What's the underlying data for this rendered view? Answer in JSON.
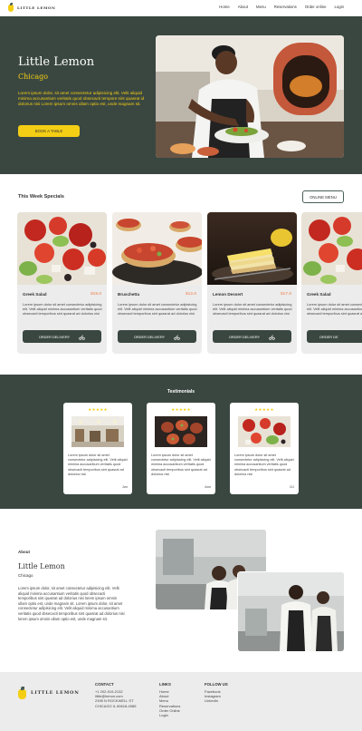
{
  "nav": {
    "logo_text": "LITTLE LEMON",
    "links": [
      "Home",
      "About",
      "Menu",
      "Reservations",
      "Order online",
      "Login"
    ]
  },
  "hero": {
    "title": "Little Lemon",
    "subtitle": "Chicago",
    "description": "Lorem ipsum dolor, sit amet consectetur adipisicing elit. Velit aliquid minima accusantium veritatis quod obsecacti tempore sint quasrat id dolorius nisi Lorem ipsum omnis ullam optio est, unde magnam sit.",
    "button": "BOOK A TABLE"
  },
  "specials": {
    "title": "This Week Specials",
    "menu_button": "ONLINE MENU",
    "items": [
      {
        "name": "Greek Salad",
        "price": "$15.0",
        "desc": "Lorem ipsum dolor sit amet consectetur adipisicing elit. Velit aliquid minima accusantium veritatis quod obsecacti temporibus sint quasrat ad dolorius nisi",
        "button": "ORDER DELIVERY"
      },
      {
        "name": "Bruschetta",
        "price": "$12.0",
        "desc": "Lorem ipsum dolor sit amet consectetur adipisicing elit. Velit aliquid minima accusantium veritatis quod obsecacti temporibus sint quasrat ad dolorius nisi",
        "button": "ORDER DELIVERY"
      },
      {
        "name": "Lemon Dessert",
        "price": "$17.0",
        "desc": "Lorem ipsum dolor sit amet consectetur adipisicing elit. Velit aliquid minima accusantium veritatis quod obsecacti temporibus sint quasrat ad dolorius nisi",
        "button": "ORDER DELIVERY"
      },
      {
        "name": "Greek Salad",
        "price": "",
        "desc": "Lorem ipsum dolor sit amet consectetur adipisicing elit. Velit aliquid minima accusantium veritatis quod obsecacti temporibus sint quasrat ad dolorius nisi",
        "button": "ORDER DE"
      }
    ]
  },
  "testimonials": {
    "title": "Testimonials",
    "items": [
      {
        "stars": "★★★★★",
        "desc": "Lorem ipsum dolor sit amet consectetur adipisicing elit. Velit aliquid minima accusantium veritatis quod obsecacti temporibus sint quasrat ad dolorius nisi",
        "name": "Jon"
      },
      {
        "stars": "★★★★★",
        "desc": "Lorem ipsum dolor sit amet consectetur adipisicing elit. Velit aliquid minima accusantium veritatis quod obsecacti temporibus sint quasrat ad dolorius nisi",
        "name": "Ann"
      },
      {
        "stars": "★★★★★",
        "desc": "Lorem ipsum dolor sit amet consectetur adipisicing elit. Velit aliquid minima accusantium veritatis quod obsecacti temporibus sint quasrat ad dolorius nisi",
        "name": "DJ"
      }
    ]
  },
  "about": {
    "label": "About",
    "title": "Little Lemon",
    "subtitle": "Chicago",
    "description": "Lorem ipsum dolor, sit amet consectetur adipisicing elit. Velit aliquid minima accusantium veritatis quod obsecacti temporibus sint quasrat ad dolorius nisi lorem ipsum omnis ullam optio est, unde magnam sit. Lorem ipsum dolor, sit amet consectetur adipisicing elit. Velit aliquid minima accusantium veritatis quod obsecacti temporibus sint quasrat ad dolorius nisi lorem ipsum omnis ullam optio est, unde magnam sit."
  },
  "footer": {
    "logo_text": "LITTLE LEMON",
    "contact": {
      "heading": "CONTACT",
      "lines": [
        "+1 202-919-2132",
        "little@lemon.com",
        "2395 N ROCKWELL ST",
        "CHICAGO IL 60618-4985"
      ]
    },
    "links": {
      "heading": "LINKS",
      "lines": [
        "Home",
        "About",
        "Menu",
        "Reservations",
        "Order Online",
        "Login"
      ]
    },
    "follow": {
      "heading": "FOLLOW US",
      "lines": [
        "Facebook",
        "Instagram",
        "LinkedIn"
      ]
    }
  },
  "colors": {
    "primary_green": "#3a4741",
    "accent_yellow": "#F4CE14",
    "price_salmon": "#ee9972",
    "card_bg": "#ececec"
  }
}
